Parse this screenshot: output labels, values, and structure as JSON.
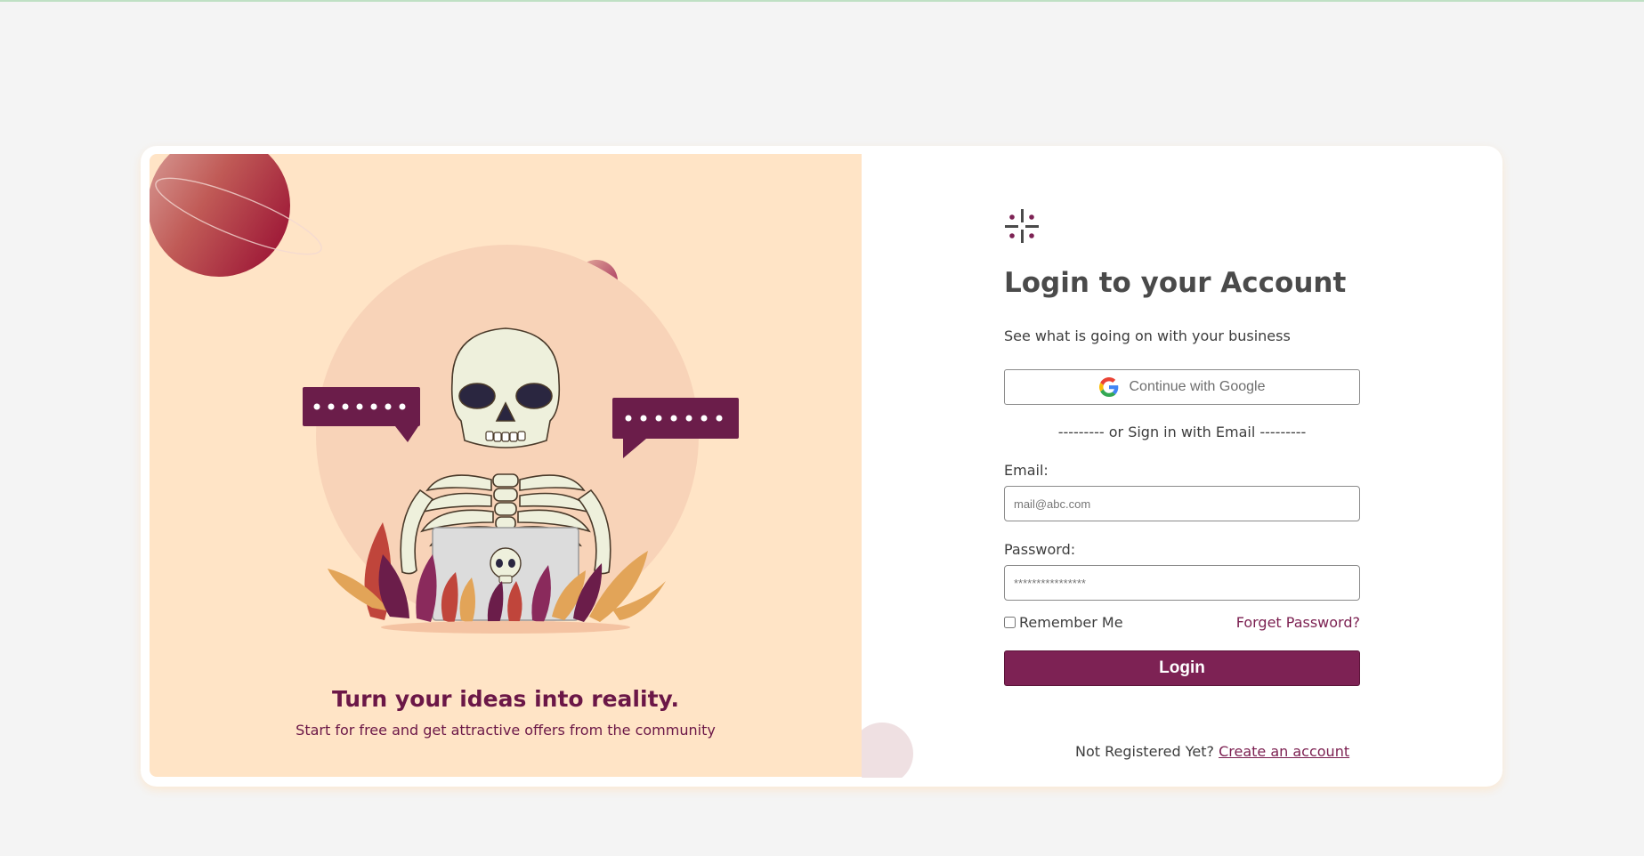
{
  "illustration": {
    "tagline": "Turn your ideas into reality.",
    "subtagline": "Start for free and get attractive offers from the community"
  },
  "login": {
    "title": "Login to your Account",
    "subtitle": "See what is going on with your business",
    "google_button": "Continue with Google",
    "divider": "--------- or Sign in with Email ---------",
    "email_label": "Email:",
    "email_placeholder": "mail@abc.com",
    "password_label": "Password:",
    "password_placeholder": "****************",
    "remember_label": "Remember Me",
    "forgot_link": "Forget Password?",
    "login_button": "Login",
    "register_prompt": "Not Registered Yet?",
    "register_link": "Create an account"
  },
  "colors": {
    "brand": "#7d2254",
    "panel_bg": "#ffe4c6",
    "page_bg": "#f4f4f4"
  },
  "icons": [
    "brand-logo-icon",
    "google-icon",
    "skeleton-illustration"
  ]
}
